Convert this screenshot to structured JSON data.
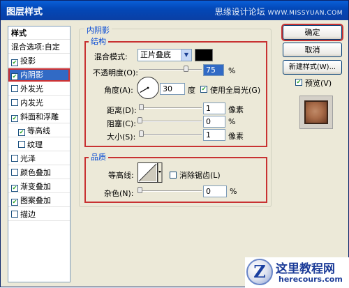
{
  "window": {
    "title": "图层样式",
    "watermark_a": "思缘设计论坛",
    "watermark_b": "WWW.MISSYUAN.COM"
  },
  "styles_list": {
    "header": "样式",
    "items": [
      {
        "label": "混合选项:自定",
        "checkbox": false,
        "checked": false
      },
      {
        "label": "投影",
        "checkbox": true,
        "checked": true
      },
      {
        "label": "内阴影",
        "checkbox": true,
        "checked": true,
        "selected": true
      },
      {
        "label": "外发光",
        "checkbox": true,
        "checked": false
      },
      {
        "label": "内发光",
        "checkbox": true,
        "checked": false
      },
      {
        "label": "斜面和浮雕",
        "checkbox": true,
        "checked": true
      },
      {
        "label": "等高线",
        "checkbox": true,
        "checked": true,
        "sub": true
      },
      {
        "label": "纹理",
        "checkbox": true,
        "checked": false,
        "sub": true
      },
      {
        "label": "光泽",
        "checkbox": true,
        "checked": false
      },
      {
        "label": "颜色叠加",
        "checkbox": true,
        "checked": false
      },
      {
        "label": "渐变叠加",
        "checkbox": true,
        "checked": true
      },
      {
        "label": "图案叠加",
        "checkbox": true,
        "checked": true
      },
      {
        "label": "描边",
        "checkbox": true,
        "checked": false
      }
    ]
  },
  "inner_shadow": {
    "group_title": "内阴影",
    "structure": {
      "title": "结构",
      "blend_mode_label": "混合模式:",
      "blend_mode_value": "正片叠底",
      "shadow_color": "#000000",
      "opacity_label": "不透明度(O):",
      "opacity_value": "75",
      "opacity_unit": "%",
      "opacity_fraction": 0.75,
      "angle_label": "角度(A):",
      "angle_value": "30",
      "angle_unit": "度",
      "global_light_label": "使用全局光(G)",
      "global_light_checked": true,
      "distance_label": "距离(D):",
      "distance_value": "1",
      "distance_unit": "像素",
      "choke_label": "阻塞(C):",
      "choke_value": "0",
      "choke_unit": "%",
      "size_label": "大小(S):",
      "size_value": "1",
      "size_unit": "像素"
    },
    "quality": {
      "title": "品质",
      "contour_label": "等高线:",
      "anti_alias_label": "消除锯齿(L)",
      "anti_alias_checked": false,
      "noise_label": "杂色(N):",
      "noise_value": "0",
      "noise_unit": "%"
    }
  },
  "buttons": {
    "ok": "确定",
    "cancel": "取消",
    "new_style": "新建样式(W)...",
    "preview_label": "预览(V)",
    "preview_checked": true
  },
  "logo": {
    "glyph": "Z",
    "name": "这里教程网",
    "url": "herecours.com"
  }
}
